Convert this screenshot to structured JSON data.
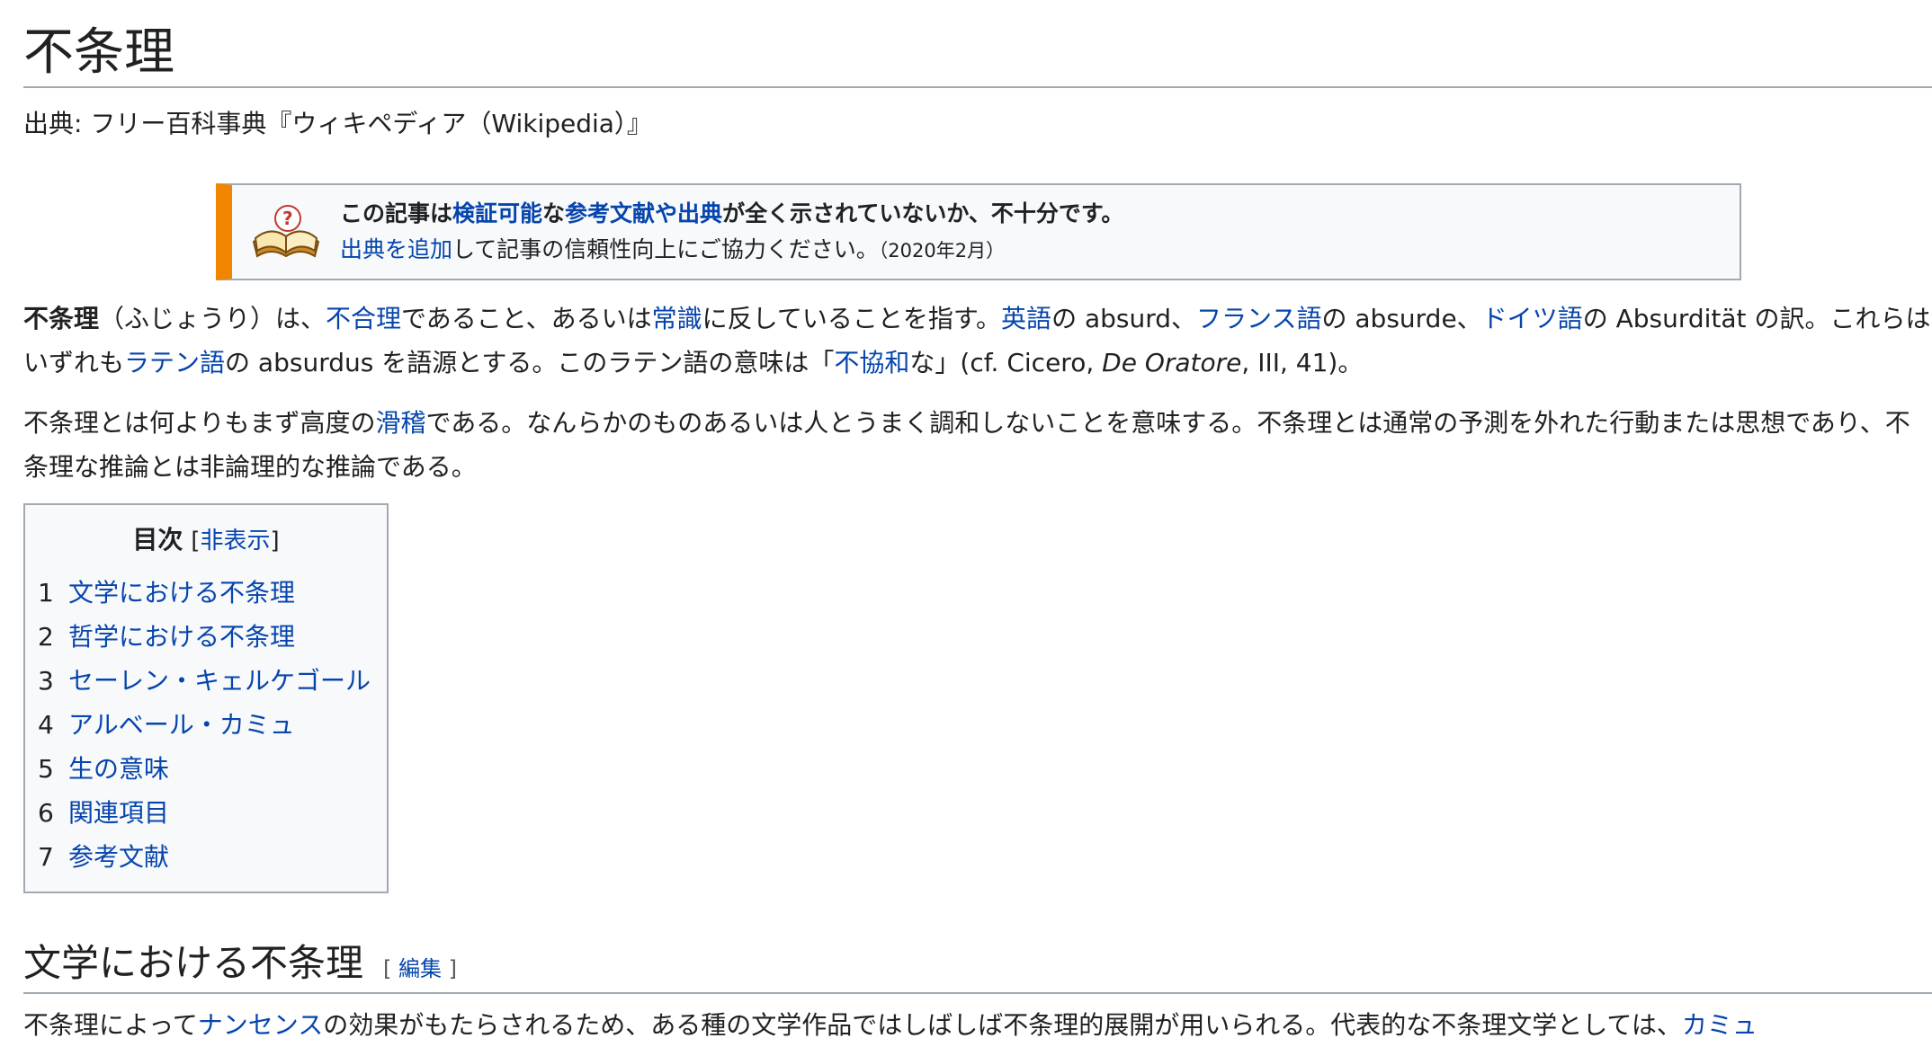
{
  "title": "不条理",
  "site_sub": "出典: フリー百科事典『ウィキペディア（Wikipedia）』",
  "ambox": {
    "l1_a": "この記事は",
    "l1_link1": "検証可能",
    "l1_b": "な",
    "l1_link2": "参考文献や出典",
    "l1_c": "が全く示されていないか、不十分です。",
    "l2_link": "出典を追加",
    "l2_a": "して記事の信頼性向上にご協力ください。",
    "l2_date": "（2020年2月）"
  },
  "p1": {
    "bold": "不条理",
    "t1": "（ふじょうり）は、",
    "l1": "不合理",
    "t2": "であること、あるいは",
    "l2": "常識",
    "t3": "に反していることを指す。",
    "l3": "英語",
    "t4": "の absurd、",
    "l4": "フランス語",
    "t5": "の absurde、",
    "l5": "ドイツ語",
    "t6": "の Absurdität の訳。これらはいずれも",
    "l6": "ラテン語",
    "t7": "の absurdus を語源とする。このラテン語の意味は「",
    "l7": "不協和",
    "t8": "な」(cf. Cicero, ",
    "italic": "De Oratore",
    "t9": ", III, 41)。"
  },
  "p2": {
    "t1": "不条理とは何よりもまず高度の",
    "l1": "滑稽",
    "t2": "である。なんらかのものあるいは人とうまく調和しないことを意味する。不条理とは通常の予測を外れた行動または思想であり、不条理な推論とは非論理的な推論である。"
  },
  "toc": {
    "title": "目次",
    "hide_open": "[",
    "hide_label": "非表示",
    "hide_close": "]",
    "items": [
      {
        "num": "1",
        "label": "文学における不条理"
      },
      {
        "num": "2",
        "label": "哲学における不条理"
      },
      {
        "num": "3",
        "label": "セーレン・キェルケゴール"
      },
      {
        "num": "4",
        "label": "アルベール・カミュ"
      },
      {
        "num": "5",
        "label": "生の意味"
      },
      {
        "num": "6",
        "label": "関連項目"
      },
      {
        "num": "7",
        "label": "参考文献"
      }
    ]
  },
  "section1": {
    "heading": "文学における不条理",
    "edit_open": "[ ",
    "edit_label": "編集",
    "edit_close": " ]"
  },
  "p3": {
    "t1": "不条理によって",
    "l1": "ナンセンス",
    "t2": "の効果がもたらされるため、ある種の文学作品ではしばしば不条理的展開が用いられる。代表的な不条理文学としては、",
    "l2": "カミュ"
  },
  "colors": {
    "link": "#0645ad",
    "text": "#202122",
    "border": "#a2a9b1",
    "ambox_accent": "#f28500",
    "box_bg": "#f8f9fa"
  },
  "icons": {
    "ambox_icon": "book-question-icon"
  }
}
